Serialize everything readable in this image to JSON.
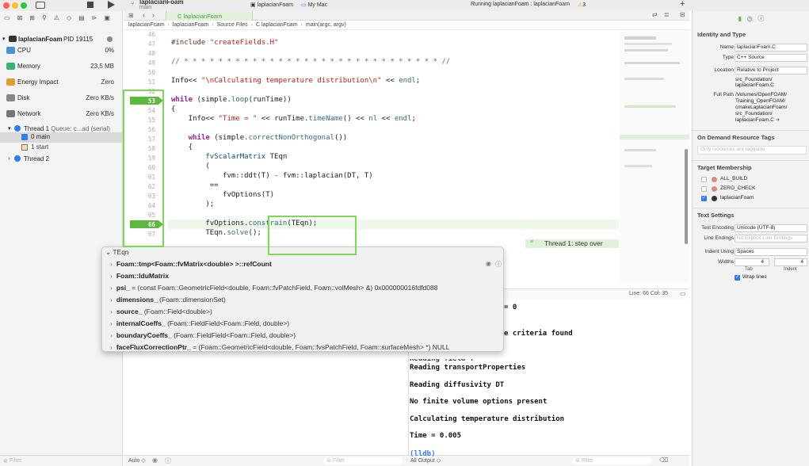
{
  "toolbar": {
    "scheme_name": "laplacianFoam",
    "scheme_sub": "main",
    "target": "laplacianFoam",
    "destination": "My Mac",
    "status": "Running laplacianFoam : laplacianFoam",
    "warnings": "3"
  },
  "navigator": {
    "process": "laplacianFoam",
    "pid": "PID 19115",
    "gauges": [
      {
        "label": "CPU",
        "value": "0%"
      },
      {
        "label": "Memory",
        "value": "23,5 MB"
      },
      {
        "label": "Energy Impact",
        "value": "Zero"
      },
      {
        "label": "Disk",
        "value": "Zero KB/s"
      },
      {
        "label": "Network",
        "value": "Zero KB/s"
      }
    ],
    "thread1": "Thread 1",
    "thread1_queue": "Queue: c...ad (serial)",
    "frame0": "0 main",
    "frame1": "1 start",
    "thread2": "Thread 2",
    "filter_placeholder": "Filter"
  },
  "tab": {
    "label": "C laplacianFoam"
  },
  "breadcrumb": [
    "laplacianFoam",
    "laplacianFoam",
    "Source Files",
    "C laplacianFoam",
    "main(argc, argv)"
  ],
  "code": {
    "lines": [
      {
        "n": "46",
        "t": ""
      },
      {
        "n": "47",
        "t": "#include \"createFields.H\""
      },
      {
        "n": "48",
        "t": ""
      },
      {
        "n": "49",
        "t": "// * * * * * * * * * * * * * * * * * * * * * * * * * * * * * * //"
      },
      {
        "n": "50",
        "t": ""
      },
      {
        "n": "51",
        "t": "Info<< \"\\nCalculating temperature distribution\\n\" << endl;"
      },
      {
        "n": "52",
        "t": ""
      },
      {
        "n": "53",
        "t": "while (simple.loop(runTime))"
      },
      {
        "n": "54",
        "t": "{"
      },
      {
        "n": "55",
        "t": "    Info<< \"Time = \" << runTime.timeName() << nl << endl;"
      },
      {
        "n": "56",
        "t": ""
      },
      {
        "n": "57",
        "t": "    while (simple.correctNonOrthogonal())"
      },
      {
        "n": "58",
        "t": "    {"
      },
      {
        "n": "59",
        "t": "        fvScalarMatrix TEqn"
      },
      {
        "n": "60",
        "t": "        ("
      },
      {
        "n": "61",
        "t": "            fvm::ddt(T) - fvm::laplacian(DT, T)"
      },
      {
        "n": "62",
        "t": "         =="
      },
      {
        "n": "63",
        "t": "            fvOptions(T)"
      },
      {
        "n": "64",
        "t": "        );"
      },
      {
        "n": "65",
        "t": ""
      },
      {
        "n": "66",
        "t": "        fvOptions.constrain(TEqn);"
      },
      {
        "n": "67",
        "t": "        TEqn.solve();"
      }
    ],
    "breakpoints": [
      "53",
      "66"
    ],
    "thread_annotation": "Thread 1: step over",
    "cursor_pos": "Line: 66  Col: 35"
  },
  "popup": {
    "title": "TEqn",
    "rows": [
      {
        "name": "Foam::tmp<Foam::fvMatrix<double> >::refCount",
        "value": ""
      },
      {
        "name": "Foam::lduMatrix",
        "value": ""
      },
      {
        "name": "psi_",
        "value": " = (const Foam::GeometricField<double, Foam::fvPatchField, Foam::volMesh> &) 0x000000016fdfd088"
      },
      {
        "name": "dimensions_",
        "value": " (Foam::dimensionSet)"
      },
      {
        "name": "source_",
        "value": " (Foam::Field<double>)"
      },
      {
        "name": "internalCoeffs_",
        "value": " (Foam::FieldField<Foam::Field, double>)"
      },
      {
        "name": "boundaryCoeffs_",
        "value": " (Foam::FieldField<Foam::Field, double>)"
      },
      {
        "name": "faceFluxCorrectionPtr_",
        "value": " = (Foam::GeometricField<double, Foam::fvsPatchField, Foam::surfaceMesh> *) NULL"
      }
    ]
  },
  "console": {
    "partial1": "= 0",
    "partial2": "e criteria found",
    "partial3": "Reading field T",
    "lines": [
      "Reading transportProperties",
      "Reading diffusivity DT",
      "No finite volume options present",
      "Calculating temperature distribution",
      "Time = 0.005"
    ],
    "prompt": "(lldb)",
    "output_select": "All Output",
    "filter_placeholder": "Filter",
    "auto_label": "Auto"
  },
  "inspector": {
    "identity_header": "Identity and Type",
    "name_label": "Name",
    "name_value": "laplacianFoam.C",
    "type_label": "Type",
    "type_value": "C++ Source",
    "location_label": "Location",
    "location_value": "Relative to Project",
    "rel_path": [
      "src_Foundation/",
      "laplacianFoam.C"
    ],
    "full_path_label": "Full Path",
    "full_path": [
      "/Volumes/OpenFOAM/",
      "Training_OpenFOAM/",
      "cmakeLaplacianFoam/",
      "src_Foundation/",
      "laplacianFoam.C"
    ],
    "odr_header": "On Demand Resource Tags",
    "odr_placeholder": "Only resources are taggable",
    "target_header": "Target Membership",
    "targets": [
      {
        "label": "ALL_BUILD",
        "checked": false
      },
      {
        "label": "ZERO_CHECK",
        "checked": false
      },
      {
        "label": "laplacianFoam",
        "checked": true
      }
    ],
    "text_header": "Text Settings",
    "encoding_label": "Text Encoding",
    "encoding_value": "Unicode (UTF-8)",
    "line_endings_label": "Line Endings",
    "line_endings_value": "No Explicit Line Endings",
    "indent_label": "Indent Using",
    "indent_value": "Spaces",
    "widths_label": "Widths",
    "tab_width": "4",
    "indent_width": "4",
    "tab_label": "Tab",
    "indent_sub_label": "Indent",
    "wrap_label": "Wrap lines"
  },
  "colors": {
    "accent": "#2f7cf6",
    "breakpoint": "#5fb83e",
    "annotation": "#7ed957"
  }
}
